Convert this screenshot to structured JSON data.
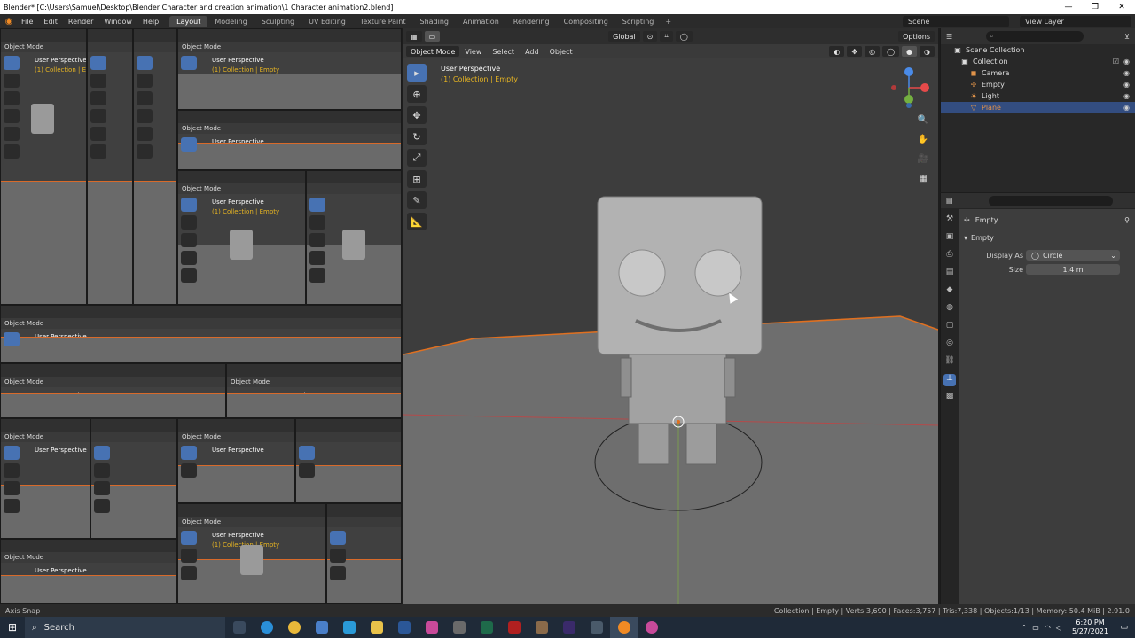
{
  "window": {
    "title": "Blender* [C:\\Users\\Samuel\\Desktop\\Blender Character and creation animation\\1 Character animation2.blend]",
    "minimize": "—",
    "maximize": "❐",
    "close": "✕"
  },
  "menubar": {
    "items": [
      "File",
      "Edit",
      "Render",
      "Window",
      "Help"
    ],
    "workspaces": [
      "Layout",
      "Modeling",
      "Sculpting",
      "UV Editing",
      "Texture Paint",
      "Shading",
      "Animation",
      "Rendering",
      "Compositing",
      "Scripting"
    ],
    "active_workspace": "Layout",
    "scene": "Scene",
    "view_layer": "View Layer"
  },
  "viewport": {
    "mode": "Object Mode",
    "menus": [
      "View",
      "Select",
      "Add",
      "Object"
    ],
    "orientation": "Global",
    "options": "Options",
    "perspective": "User Perspective",
    "collection_label": "(1) Collection | Empty"
  },
  "tiles": {
    "mode": "Object Mode",
    "perspective": "User Perspective",
    "collection_label": "(1) Collection | Empty"
  },
  "outliner": {
    "root": "Scene Collection",
    "collection": "Collection",
    "items": [
      {
        "name": "Camera",
        "icon": "camera-icon"
      },
      {
        "name": "Empty",
        "icon": "empty-icon"
      },
      {
        "name": "Light",
        "icon": "light-icon"
      },
      {
        "name": "Plane",
        "icon": "mesh-icon"
      }
    ],
    "selected": "Plane"
  },
  "properties": {
    "object_name": "Empty",
    "panel": "Empty",
    "display_as_label": "Display As",
    "display_as_value": "Circle",
    "size_label": "Size",
    "size_value": "1.4 m"
  },
  "statusbar": {
    "left": "Axis Snap",
    "right": "Collection | Empty | Verts:3,690 | Faces:3,757 | Tris:7,338 | Objects:1/13 | Memory: 50.4 MiB | 2.91.0"
  },
  "taskbar": {
    "search_placeholder": "Search",
    "time": "6:20 PM",
    "date": "5/27/2021"
  },
  "colors": {
    "accent": "#4772b3",
    "active_label": "#e6b422",
    "floor_edge": "#d86a2a",
    "selected_row": "#334d80"
  }
}
